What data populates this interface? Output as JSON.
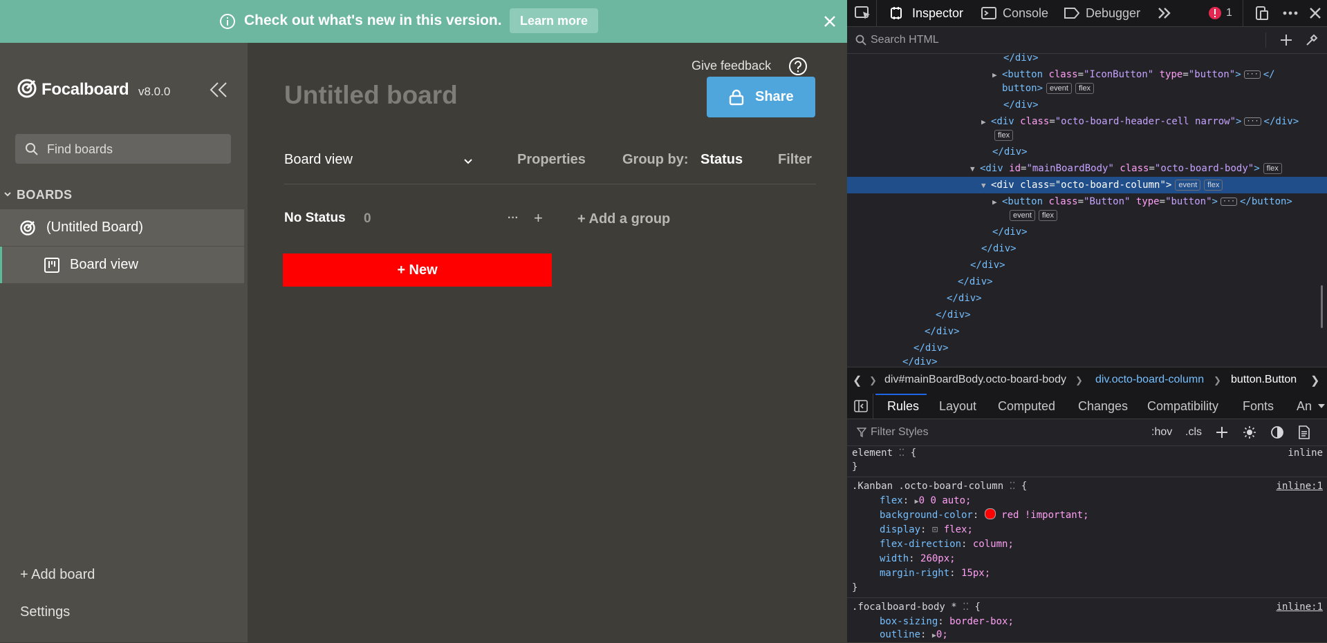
{
  "banner": {
    "text": "Check out what's new in this version.",
    "learn_more": "Learn more"
  },
  "sidebar": {
    "app_name": "Focalboard",
    "version": "v8.0.0",
    "search_placeholder": "Find boards",
    "boards_header": "BOARDS",
    "board_name": "(Untitled Board)",
    "view_name": "Board view",
    "add_board": "+ Add board",
    "settings": "Settings"
  },
  "main": {
    "give_feedback": "Give feedback",
    "share": "Share",
    "board_title": "Untitled board",
    "view_select": "Board view",
    "properties": "Properties",
    "group_by_label": "Group by:",
    "group_by_value": "Status",
    "filter": "Filter",
    "group": {
      "name": "No Status",
      "count": "0",
      "more": "···",
      "add": "+"
    },
    "add_group": "+ Add a group",
    "new_button": "+ New",
    "new_button_color": "#ff0000"
  },
  "devtools": {
    "tabs": [
      "Inspector",
      "Console",
      "Debugger"
    ],
    "error_count": "1",
    "search_placeholder": "Search HTML",
    "markup_lines": [
      {
        "text": "</div>"
      },
      {
        "text": "<button class=\"IconButton\" type=\"button\"> ··· </"
      },
      {
        "text": "button>"
      },
      {
        "text": "</div>"
      },
      {
        "text": "<div class=\"octo-board-header-cell narrow\"> ··· </div>"
      },
      {
        "text": "flex"
      },
      {
        "text": "</div>"
      },
      {
        "text": "<div id=\"mainBoardBody\" class=\"octo-board-body\">"
      },
      {
        "text": "<div class=\"octo-board-column\">"
      },
      {
        "text": "<button class=\"Button\" type=\"button\"> ··· </button>"
      },
      {
        "text": "</div>"
      }
    ],
    "badges": {
      "event": "event",
      "flex": "flex"
    },
    "breadcrumbs": [
      "div#mainBoardBody.octo-board-body",
      "div.octo-board-column",
      "button.Button"
    ],
    "rule_tabs": [
      "Rules",
      "Layout",
      "Computed",
      "Changes",
      "Compatibility",
      "Fonts",
      "An"
    ],
    "filter_placeholder": "Filter Styles",
    "filter_buttons": [
      ":hov",
      ".cls"
    ],
    "rules": {
      "element_selector": "element",
      "element_source": "inline",
      "kanban_selector": ".Kanban .octo-board-column",
      "kanban_source": "inline:1",
      "kanban_props": [
        {
          "name": "flex",
          "value": "0 0 auto;"
        },
        {
          "name": "background-color",
          "value": "red !important;"
        },
        {
          "name": "display",
          "value": "flex;"
        },
        {
          "name": "flex-direction",
          "value": "column;"
        },
        {
          "name": "width",
          "value": "260px;"
        },
        {
          "name": "margin-right",
          "value": "15px;"
        }
      ],
      "body_selector": ".focalboard-body *",
      "body_source": "inline:1",
      "body_props": [
        {
          "name": "box-sizing",
          "value": "border-box;"
        },
        {
          "name": "outline",
          "value": "0;"
        }
      ]
    }
  },
  "colors": {
    "banner_bg": "#6db7a1",
    "sidebar_bg": "#4f4d48",
    "main_bg": "#3f3d38",
    "share_bg": "#4ea6dd",
    "devtools_bg": "#232327",
    "selected_row": "#204e8a"
  }
}
